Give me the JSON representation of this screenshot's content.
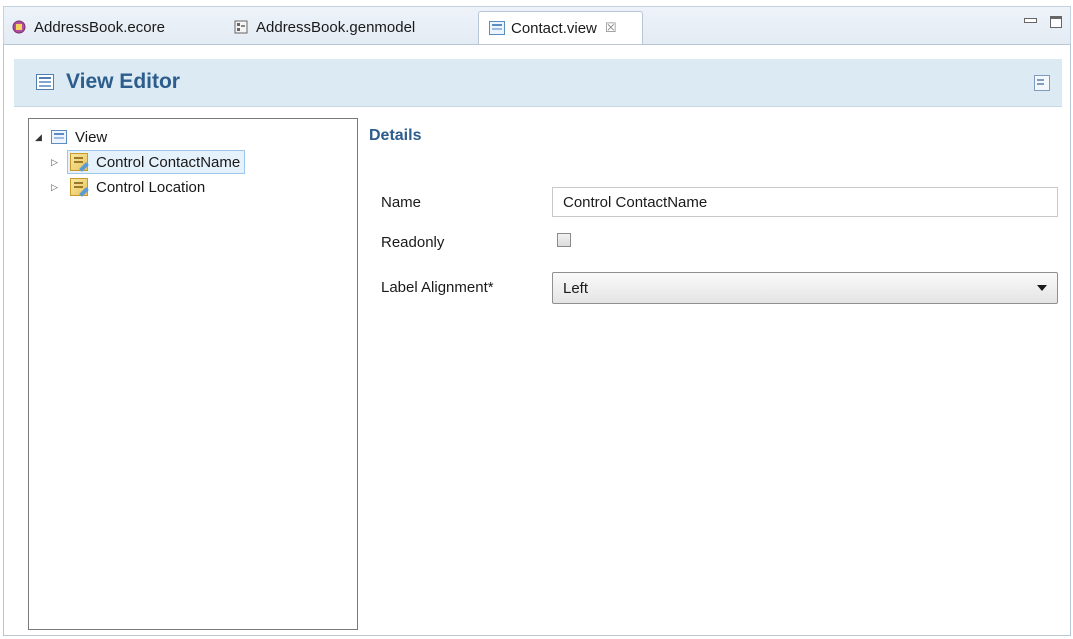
{
  "tabs": [
    {
      "label": "AddressBook.ecore",
      "icon": "ecore-icon",
      "active": false
    },
    {
      "label": "AddressBook.genmodel",
      "icon": "genmodel-icon",
      "active": false
    },
    {
      "label": "Contact.view",
      "icon": "view-icon",
      "active": true
    }
  ],
  "tab_close_glyph": "☒",
  "editor": {
    "title": "View Editor"
  },
  "tree": {
    "root": {
      "label": "View",
      "expanded": true
    },
    "children": [
      {
        "label": "Control ContactName",
        "selected": true
      },
      {
        "label": "Control Location",
        "selected": false
      }
    ]
  },
  "details": {
    "title": "Details",
    "name_label": "Name",
    "name_value": "Control ContactName",
    "readonly_label": "Readonly",
    "readonly_checked": false,
    "label_alignment_label": "Label Alignment*",
    "label_alignment_value": "Left"
  },
  "colors": {
    "header_bg": "#dceaf3",
    "title_blue": "#2c5d8c",
    "selection_bg": "#e5f1fb"
  }
}
